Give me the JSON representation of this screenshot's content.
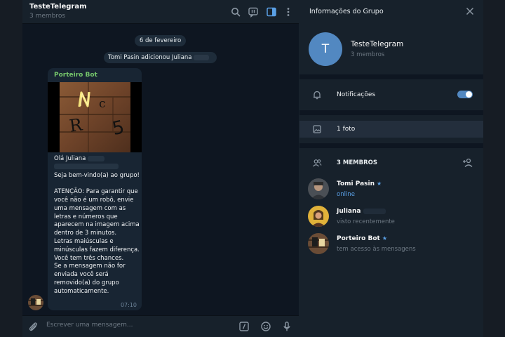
{
  "chat": {
    "title": "TesteTelegram",
    "subtitle": "3 membros",
    "date_pill": "6 de fevereiro",
    "service_message": "Tomi Pasin adicionou Juliana",
    "message": {
      "sender": "Porteiro Bot",
      "greeting": "Olá Juliana",
      "body": "Seja bem-vindo(a) ao grupo!\n\nATENÇÃO: Para garantir que você não é um robô, envie uma mensagem com as letras e números que aparecem na imagem acima dentro de 3 minutos.\nLetras maiúsculas e minúsculas fazem diferença.\nVocê tem três chances.\nSe a mensagem não for enviada você será removido(a) do grupo automaticamente.",
      "time": "07:10",
      "captcha_image": "captcha-photo"
    },
    "composer_placeholder": "Escrever uma mensagem..."
  },
  "info": {
    "title": "Informações do Grupo",
    "group_initial": "T",
    "group_name": "TesteTelegram",
    "group_members": "3 membros",
    "notifications_label": "Notificações",
    "notifications_on": true,
    "photos_label": "1 foto",
    "members_header": "3 MEMBROS",
    "members": [
      {
        "name": "Tomi Pasin",
        "status": "online",
        "starred": true
      },
      {
        "name": "Juliana",
        "status": "visto recentemente",
        "starred": false
      },
      {
        "name": "Porteiro Bot",
        "status": "tem acesso às mensagens",
        "starred": true
      }
    ]
  },
  "colors": {
    "accent": "#5288c1",
    "sender_green": "#75c66b",
    "online_blue": "#5aa0e6"
  }
}
